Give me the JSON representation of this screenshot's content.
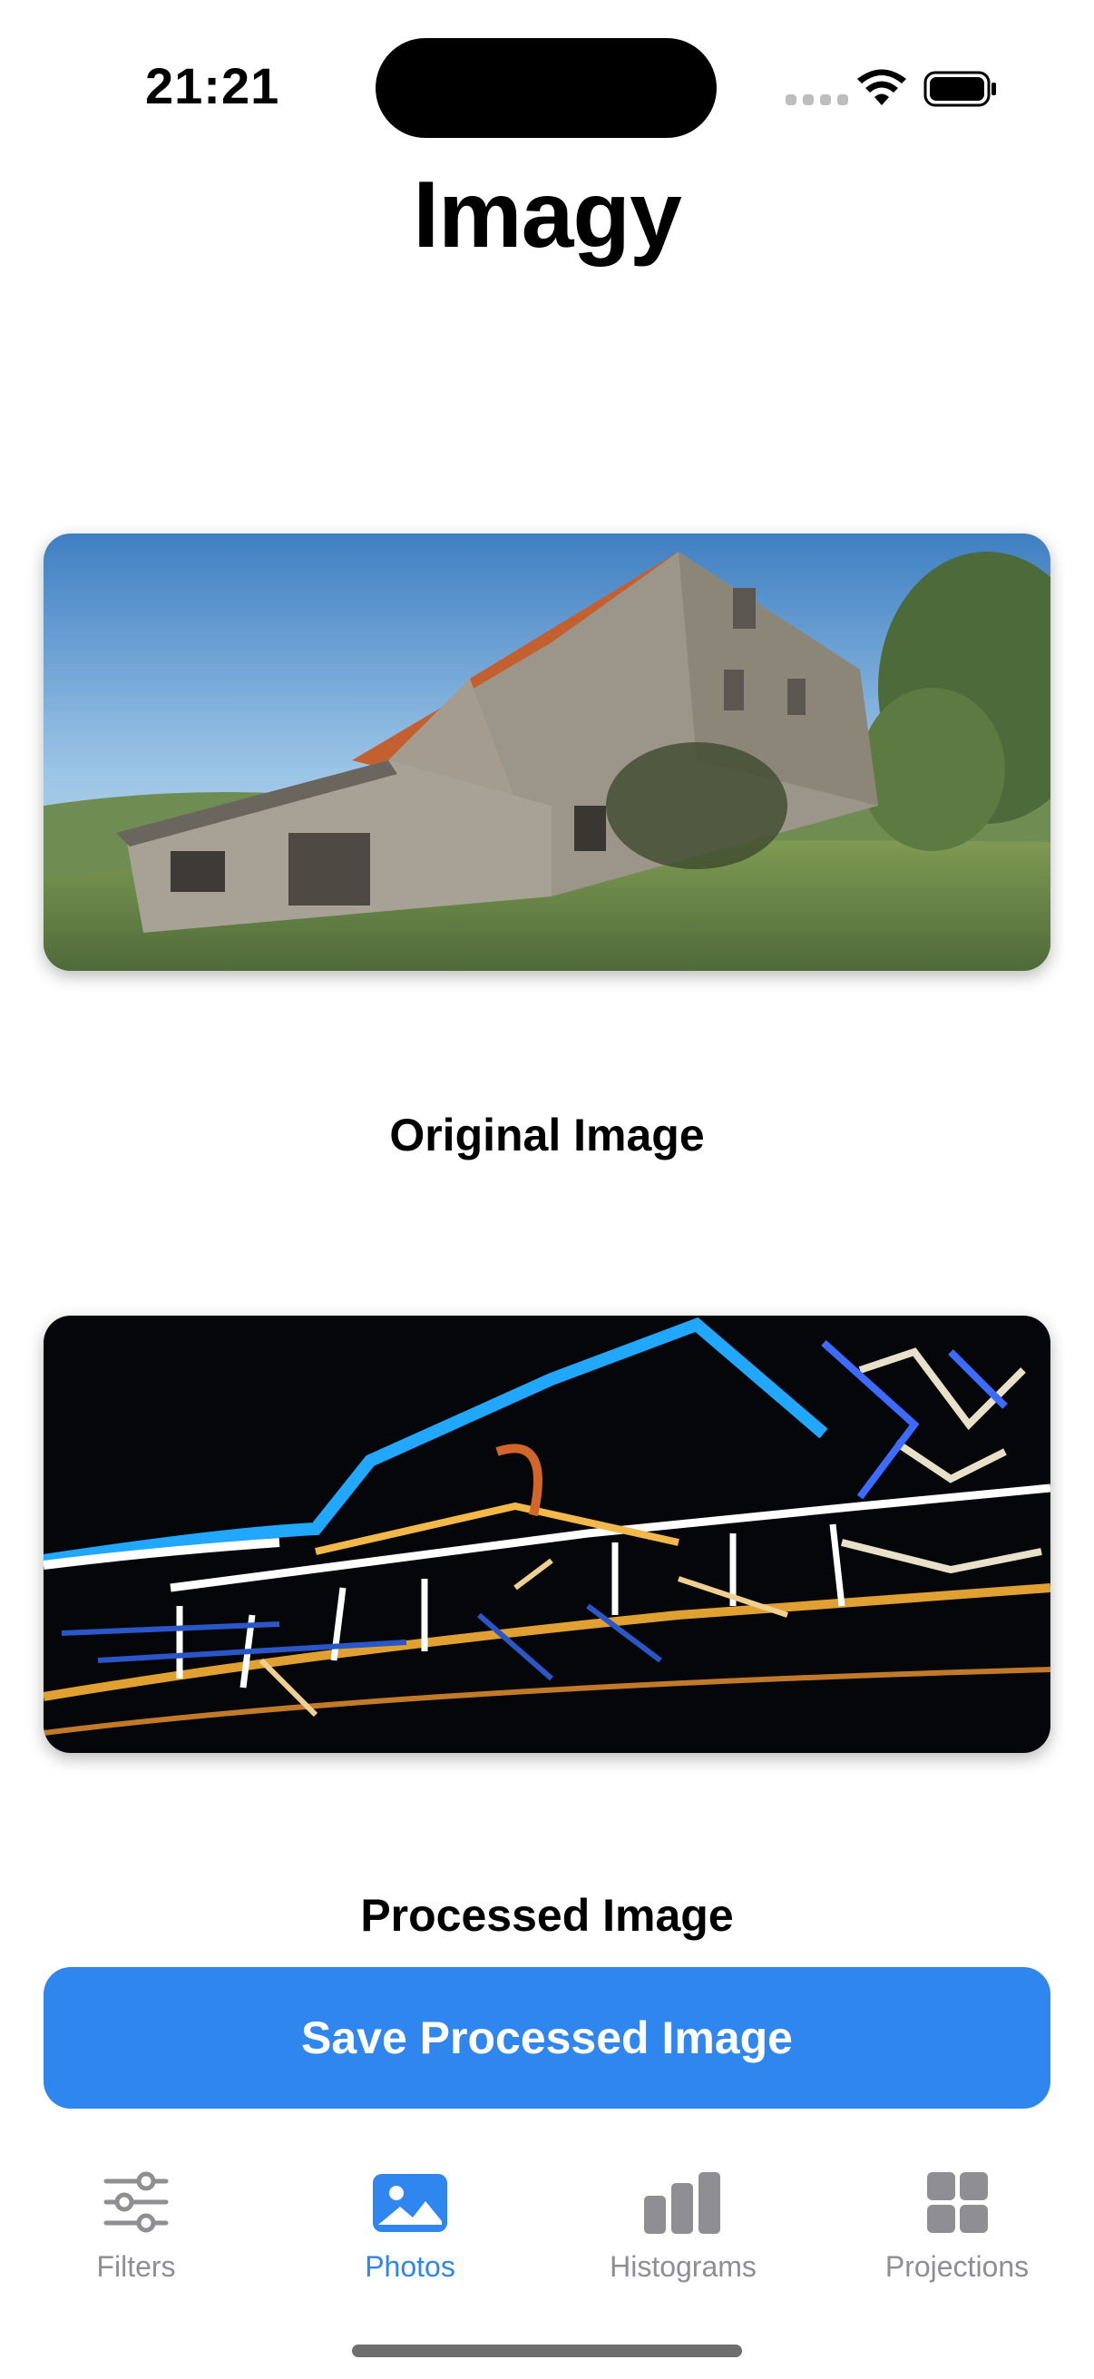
{
  "status_bar": {
    "time": "21:21"
  },
  "app": {
    "title": "Imagy"
  },
  "images": {
    "original_caption": "Original Image",
    "processed_caption": "Processed Image"
  },
  "actions": {
    "save_label": "Save Processed Image"
  },
  "tab_bar": {
    "active_tab": "Photos",
    "tabs": [
      {
        "label": "Filters",
        "icon": "sliders-icon"
      },
      {
        "label": "Photos",
        "icon": "photo-icon"
      },
      {
        "label": "Histograms",
        "icon": "bar-chart-icon"
      },
      {
        "label": "Projections",
        "icon": "grid-icon"
      }
    ]
  },
  "colors": {
    "accent": "#2e86ee",
    "inactive": "#8e8e93",
    "background": "#ffffff"
  }
}
